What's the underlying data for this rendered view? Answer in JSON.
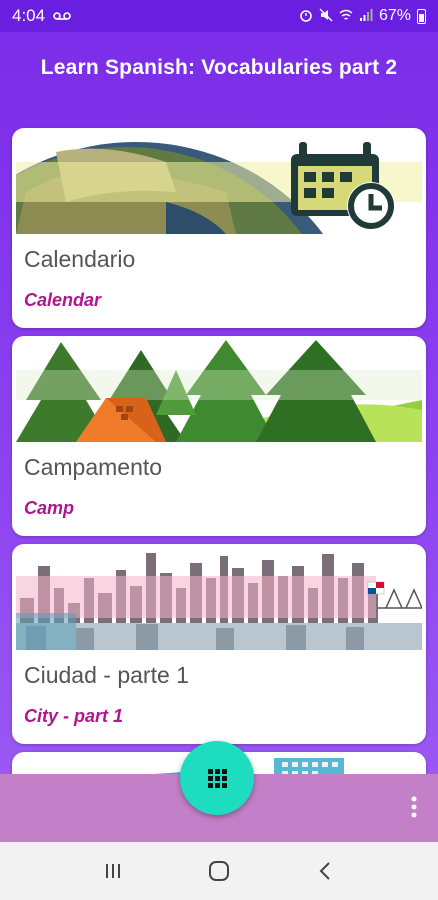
{
  "status_bar": {
    "time": "4:04",
    "battery_percent": "67%",
    "icons": [
      "voicemail-icon",
      "alarm-icon",
      "mute-icon",
      "wifi-icon",
      "signal-icon",
      "battery-icon"
    ]
  },
  "app_bar": {
    "title": "Learn Spanish: Vocabularies part 2"
  },
  "cards": [
    {
      "title": "Calendario",
      "subtitle": "Calendar",
      "image": "calendar-earth-image"
    },
    {
      "title": "Campamento",
      "subtitle": "Camp",
      "image": "camp-forest-image"
    },
    {
      "title": "Ciudad - parte 1",
      "subtitle": "City - part 1",
      "image": "city-skyline-image"
    },
    {
      "title": "",
      "subtitle": "",
      "image": "partial-card-image"
    }
  ],
  "fab": {
    "icon": "grid-icon"
  },
  "bottom_bar": {
    "more_icon": "more-vertical-icon"
  },
  "nav_bar": {
    "icons": [
      "recent-apps-icon",
      "home-icon",
      "back-icon"
    ]
  },
  "colors": {
    "primary": "#7a2be8",
    "accent": "#1ddcc0",
    "subtitle": "#b3158f",
    "bottom_bar": "#c47fc9"
  }
}
